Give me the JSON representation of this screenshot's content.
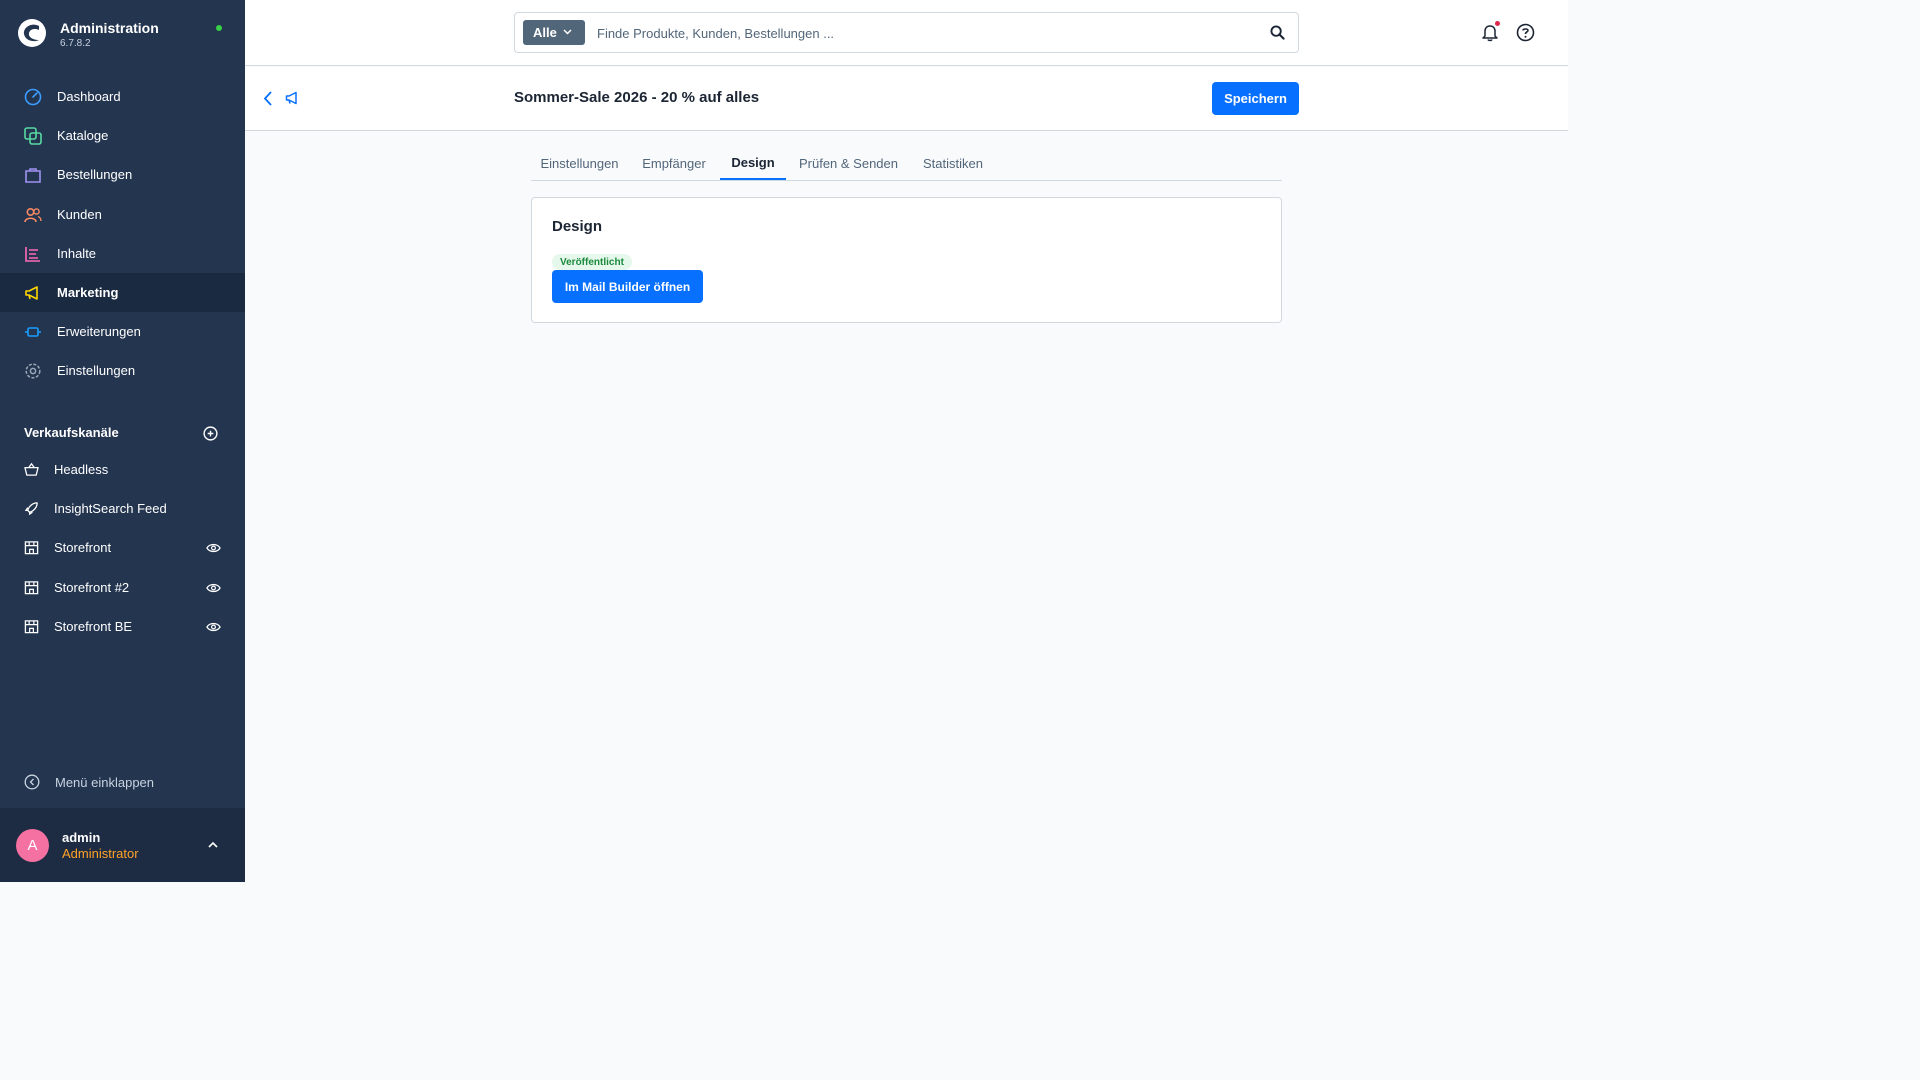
{
  "app": {
    "title": "Administration",
    "version": "6.7.8.2",
    "status_color": "#37d046"
  },
  "sidebar": {
    "items": [
      {
        "label": "Dashboard",
        "icon": "dashboard-icon",
        "color": "#3c9dff"
      },
      {
        "label": "Kataloge",
        "icon": "catalog-icon",
        "color": "#57d9a3"
      },
      {
        "label": "Bestellungen",
        "icon": "orders-icon",
        "color": "#a092f0"
      },
      {
        "label": "Kunden",
        "icon": "customers-icon",
        "color": "#f88962"
      },
      {
        "label": "Inhalte",
        "icon": "content-icon",
        "color": "#ff68b4"
      },
      {
        "label": "Marketing",
        "icon": "marketing-icon",
        "color": "#ffd700",
        "active": true
      },
      {
        "label": "Erweiterungen",
        "icon": "extensions-icon",
        "color": "#189eff"
      },
      {
        "label": "Einstellungen",
        "icon": "settings-icon",
        "color": "#9aa8b5"
      }
    ],
    "sales_channels_title": "Verkaufskanäle",
    "sales_channels": [
      {
        "label": "Headless",
        "icon": "basket-icon",
        "eye": false
      },
      {
        "label": "InsightSearch Feed",
        "icon": "rocket-icon",
        "eye": false
      },
      {
        "label": "Storefront",
        "icon": "storefront-icon",
        "eye": true
      },
      {
        "label": "Storefront #2",
        "icon": "storefront-icon",
        "eye": true
      },
      {
        "label": "Storefront BE",
        "icon": "storefront-icon",
        "eye": true
      }
    ],
    "collapse_label": "Menü einklappen",
    "user": {
      "initial": "A",
      "name": "admin",
      "role": "Administrator"
    }
  },
  "search": {
    "type_label": "Alle",
    "placeholder": "Finde Produkte, Kunden, Bestellungen ..."
  },
  "smartbar": {
    "title": "Sommer-Sale 2026 - 20 % auf alles",
    "save_label": "Speichern"
  },
  "tabs": [
    {
      "label": "Einstellungen"
    },
    {
      "label": "Empfänger"
    },
    {
      "label": "Design",
      "active": true
    },
    {
      "label": "Prüfen & Senden"
    },
    {
      "label": "Statistiken"
    }
  ],
  "design_card": {
    "title": "Design",
    "status_badge": "Veröffentlicht",
    "button_label": "Im Mail Builder öffnen"
  },
  "colors": {
    "primary": "#0870ff",
    "sidebar": "#243550"
  }
}
